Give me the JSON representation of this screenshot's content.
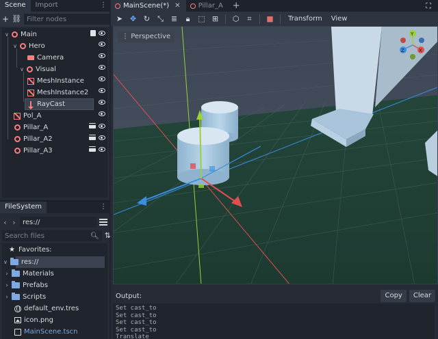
{
  "colors": {
    "accent": "#6fa8ff",
    "node_red": "#fc7f7f",
    "folder_blue": "#7fa9e0",
    "axis_x": "#e05050",
    "axis_y": "#9ad03a",
    "axis_z": "#3a8fe0"
  },
  "left_dock": {
    "tabs": [
      {
        "label": "Scene"
      },
      {
        "label": "Import"
      }
    ],
    "menu_glyph": "⋮",
    "add_icon": "plus-icon",
    "link_icon": "link-icon",
    "filter_placeholder": "Filter nodes",
    "script_icon": "attach-script-icon"
  },
  "scene_tree": [
    {
      "label": "Main",
      "icon": "spatial-icon"
    },
    {
      "label": "Hero",
      "icon": "spatial-icon"
    },
    {
      "label": "Camera",
      "icon": "camera-icon"
    },
    {
      "label": "Visual",
      "icon": "spatial-icon"
    },
    {
      "label": "MeshInstance",
      "icon": "mesh-icon"
    },
    {
      "label": "MeshInstance2",
      "icon": "mesh-icon"
    },
    {
      "label": "RayCast",
      "icon": "raycast-icon"
    },
    {
      "label": "Pol_A",
      "icon": "mesh-icon"
    },
    {
      "label": "Pillar_A",
      "icon": "spatial-icon"
    },
    {
      "label": "Pillar_A2",
      "icon": "spatial-icon"
    },
    {
      "label": "Pillar_A3",
      "icon": "spatial-icon"
    }
  ],
  "filesystem": {
    "tab": "FileSystem",
    "menu_glyph": "⋮",
    "path": "res://",
    "search_placeholder": "Search files",
    "favorites_label": "Favorites:",
    "items": [
      {
        "label": "res://",
        "type": "folder"
      },
      {
        "label": "Materials",
        "type": "folder"
      },
      {
        "label": "Prefabs",
        "type": "folder"
      },
      {
        "label": "Scripts",
        "type": "folder"
      },
      {
        "label": "default_env.tres",
        "type": "resource"
      },
      {
        "label": "icon.png",
        "type": "image"
      },
      {
        "label": "MainScene.tscn",
        "type": "scene"
      }
    ]
  },
  "scene_tabs": [
    {
      "label": "MainScene(*)",
      "active": true
    },
    {
      "label": "Pillar_A",
      "active": false
    }
  ],
  "add_tab_glyph": "+",
  "expand_glyph": "⛶",
  "viewport_toolbar": {
    "transform_menu": "Transform",
    "view_menu": "View"
  },
  "viewport": {
    "perspective_label": "Perspective",
    "gizmo_labels": {
      "y": "Y",
      "x": "X",
      "z": "Z"
    }
  },
  "output": {
    "title": "Output:",
    "copy_label": "Copy",
    "clear_label": "Clear",
    "lines": [
      "Set cast_to",
      "Set cast_to",
      "Set cast_to",
      "Set cast_to",
      "Translate"
    ]
  }
}
